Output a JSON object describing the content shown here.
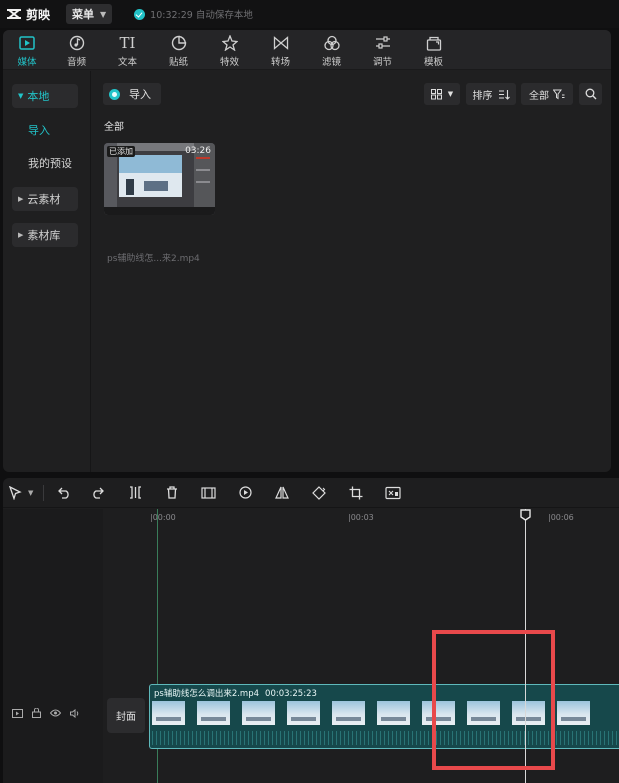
{
  "app": {
    "name": "剪映",
    "menu_label": "菜单",
    "autosave_text": "10:32:29 自动保存本地"
  },
  "toolbar": {
    "tabs": [
      {
        "label": "媒体",
        "icon": "media-icon",
        "active": true
      },
      {
        "label": "音频",
        "icon": "audio-icon"
      },
      {
        "label": "文本",
        "icon": "text-icon",
        "glyph": "TI"
      },
      {
        "label": "贴纸",
        "icon": "sticker-icon"
      },
      {
        "label": "特效",
        "icon": "effects-icon"
      },
      {
        "label": "转场",
        "icon": "transition-icon"
      },
      {
        "label": "滤镜",
        "icon": "filter-icon"
      },
      {
        "label": "调节",
        "icon": "adjust-icon"
      },
      {
        "label": "模板",
        "icon": "template-icon"
      }
    ]
  },
  "sidebar": {
    "local": "本地",
    "import": "导入",
    "my_presets": "我的预设",
    "cloud": "云素材",
    "library": "素材库"
  },
  "media": {
    "import_label": "导入",
    "sort_label": "排序",
    "filter_label": "全部",
    "section_label": "全部",
    "item": {
      "added_badge": "已添加",
      "duration": "03:26",
      "filename": "ps辅助线怎...来2.mp4"
    }
  },
  "timeline": {
    "ruler": [
      "00:00",
      "00:03",
      "00:06"
    ],
    "cover_label": "封面",
    "clip": {
      "title": "ps辅助线怎么调出来2.mp4",
      "duration": "00:03:25:23"
    }
  },
  "colors": {
    "accent": "#22c3c8",
    "highlight": "#e8494b",
    "clip_bg": "#16484b"
  }
}
